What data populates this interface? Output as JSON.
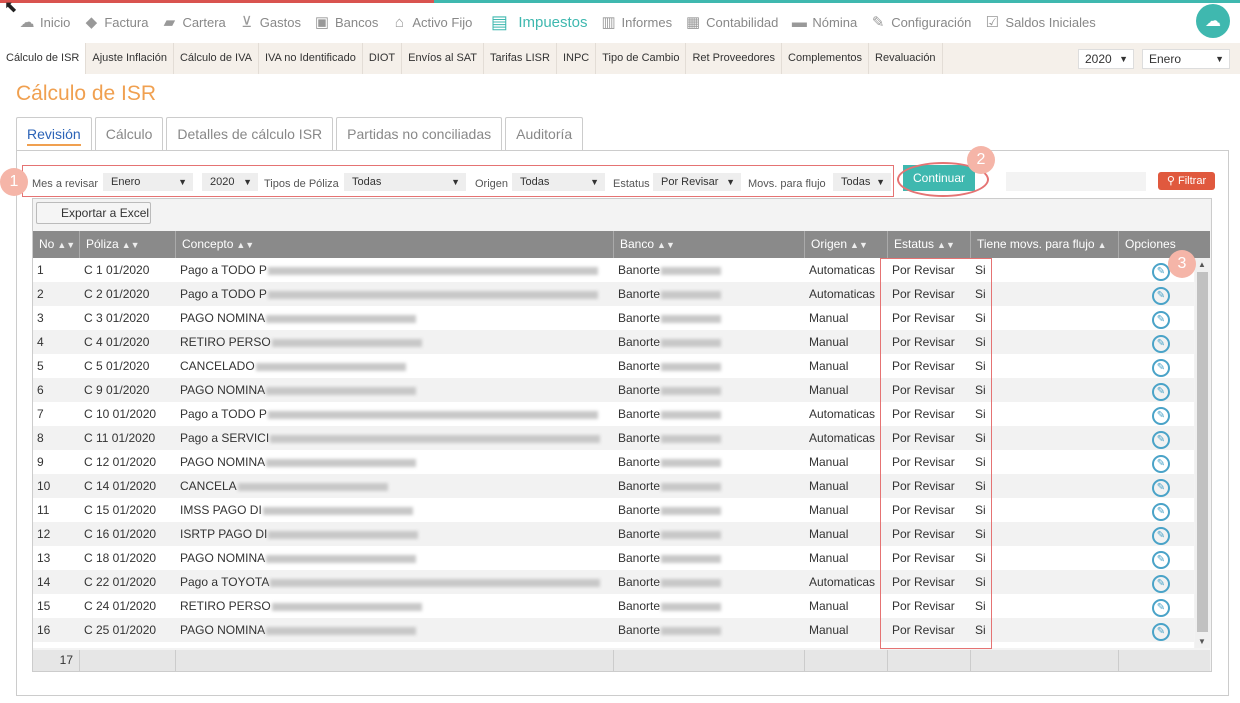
{
  "nav": {
    "items": [
      {
        "label": "Inicio",
        "icon": "cloud-icon"
      },
      {
        "label": "Factura",
        "icon": "tag-icon"
      },
      {
        "label": "Cartera",
        "icon": "wallet-icon"
      },
      {
        "label": "Gastos",
        "icon": "cart-icon"
      },
      {
        "label": "Bancos",
        "icon": "safe-icon"
      },
      {
        "label": "Activo Fijo",
        "icon": "house-icon"
      },
      {
        "label": "Impuestos",
        "icon": "cash-icon"
      },
      {
        "label": "Informes",
        "icon": "document-icon"
      },
      {
        "label": "Contabilidad",
        "icon": "clipboard-icon"
      },
      {
        "label": "Nómina",
        "icon": "card-icon"
      },
      {
        "label": "Configuración",
        "icon": "wrench-icon"
      },
      {
        "label": "Saldos Iniciales",
        "icon": "checklist-icon"
      }
    ]
  },
  "subnav": {
    "items": [
      "Cálculo de ISR",
      "Ajuste Inflación",
      "Cálculo de IVA",
      "IVA no Identificado",
      "DIOT",
      "Envíos al SAT",
      "Tarifas LISR",
      "INPC",
      "Tipo de Cambio",
      "Ret Proveedores",
      "Complementos",
      "Revaluación"
    ],
    "year": "2020",
    "month": "Enero"
  },
  "page": {
    "title": "Cálculo de ISR"
  },
  "tabs": [
    "Revisión",
    "Cálculo",
    "Detalles de cálculo ISR",
    "Partidas no conciliadas",
    "Auditoría"
  ],
  "filters": {
    "mes_label": "Mes a revisar",
    "mes_value": "Enero",
    "year_value": "2020",
    "tipos_label": "Tipos de Póliza",
    "tipos_value": "Todas",
    "origen_label": "Origen",
    "origen_value": "Todas",
    "estatus_label": "Estatus",
    "estatus_value": "Por Revisar",
    "movs_label": "Movs. para flujo",
    "movs_value": "Todas",
    "continuar": "Continuar",
    "filtrar": "Filtrar",
    "export": "Exportar a Excel"
  },
  "callouts": [
    "1",
    "2",
    "3"
  ],
  "table": {
    "headers": [
      "No",
      "Póliza",
      "Concepto",
      "Banco",
      "Origen",
      "Estatus",
      "Tiene movs. para flujo",
      "Opciones"
    ],
    "rows": [
      {
        "no": "1",
        "poliza": "C 1 01/2020",
        "concepto": "Pago a TODO P",
        "banco": "Banorte",
        "origen": "Automaticas",
        "estatus": "Por Revisar",
        "flujo": "Si"
      },
      {
        "no": "2",
        "poliza": "C 2 01/2020",
        "concepto": "Pago a TODO P",
        "banco": "Banorte",
        "origen": "Automaticas",
        "estatus": "Por Revisar",
        "flujo": "Si"
      },
      {
        "no": "3",
        "poliza": "C 3 01/2020",
        "concepto": "PAGO NOMINA",
        "banco": "Banorte",
        "origen": "Manual",
        "estatus": "Por Revisar",
        "flujo": "Si"
      },
      {
        "no": "4",
        "poliza": "C 4 01/2020",
        "concepto": "RETIRO PERSO",
        "banco": "Banorte",
        "origen": "Manual",
        "estatus": "Por Revisar",
        "flujo": "Si"
      },
      {
        "no": "5",
        "poliza": "C 5 01/2020",
        "concepto": "CANCELADO",
        "banco": "Banorte",
        "origen": "Manual",
        "estatus": "Por Revisar",
        "flujo": "Si"
      },
      {
        "no": "6",
        "poliza": "C 9 01/2020",
        "concepto": "PAGO NOMINA",
        "banco": "Banorte",
        "origen": "Manual",
        "estatus": "Por Revisar",
        "flujo": "Si"
      },
      {
        "no": "7",
        "poliza": "C 10 01/2020",
        "concepto": "Pago a TODO P",
        "banco": "Banorte",
        "origen": "Automaticas",
        "estatus": "Por Revisar",
        "flujo": "Si"
      },
      {
        "no": "8",
        "poliza": "C 11 01/2020",
        "concepto": "Pago a SERVICI",
        "banco": "Banorte",
        "origen": "Automaticas",
        "estatus": "Por Revisar",
        "flujo": "Si"
      },
      {
        "no": "9",
        "poliza": "C 12 01/2020",
        "concepto": "PAGO NOMINA",
        "banco": "Banorte",
        "origen": "Manual",
        "estatus": "Por Revisar",
        "flujo": "Si"
      },
      {
        "no": "10",
        "poliza": "C 14 01/2020",
        "concepto": "CANCELA",
        "banco": "Banorte",
        "origen": "Manual",
        "estatus": "Por Revisar",
        "flujo": "Si"
      },
      {
        "no": "11",
        "poliza": "C 15 01/2020",
        "concepto": "IMSS PAGO DI",
        "banco": "Banorte",
        "origen": "Manual",
        "estatus": "Por Revisar",
        "flujo": "Si"
      },
      {
        "no": "12",
        "poliza": "C 16 01/2020",
        "concepto": "ISRTP PAGO DI",
        "banco": "Banorte",
        "origen": "Manual",
        "estatus": "Por Revisar",
        "flujo": "Si"
      },
      {
        "no": "13",
        "poliza": "C 18 01/2020",
        "concepto": "PAGO NOMINA",
        "banco": "Banorte",
        "origen": "Manual",
        "estatus": "Por Revisar",
        "flujo": "Si"
      },
      {
        "no": "14",
        "poliza": "C 22 01/2020",
        "concepto": "Pago a TOYOTA",
        "banco": "Banorte",
        "origen": "Automaticas",
        "estatus": "Por Revisar",
        "flujo": "Si"
      },
      {
        "no": "15",
        "poliza": "C 24 01/2020",
        "concepto": "RETIRO PERSO",
        "banco": "Banorte",
        "origen": "Manual",
        "estatus": "Por Revisar",
        "flujo": "Si"
      },
      {
        "no": "16",
        "poliza": "C 25 01/2020",
        "concepto": "PAGO NOMINA",
        "banco": "Banorte",
        "origen": "Manual",
        "estatus": "Por Revisar",
        "flujo": "Si"
      }
    ],
    "footer_count": "17"
  },
  "colors": {
    "accent": "#3fb8af",
    "title": "#f0a050",
    "callout": "#f5b5a8",
    "highlight": "#e57373",
    "filter_btn": "#e0593e"
  }
}
